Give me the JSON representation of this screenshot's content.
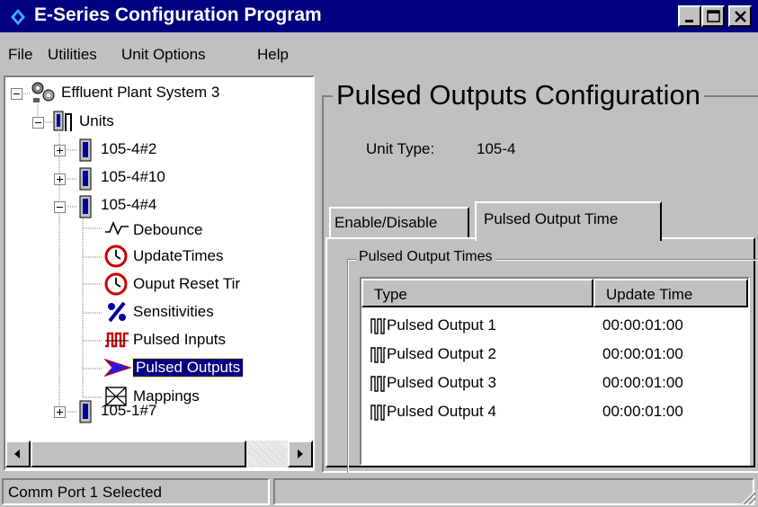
{
  "window": {
    "title": "E-Series Configuration Program",
    "controls": {
      "minimize": "minimize-icon",
      "maximize": "maximize-icon",
      "close": "close-icon"
    }
  },
  "menu": {
    "items": [
      {
        "label": "File"
      },
      {
        "label": "Utilities"
      },
      {
        "label": "Unit Options"
      },
      {
        "label": "Help"
      }
    ]
  },
  "tree": {
    "nodes": [
      {
        "label": "Effluent Plant System 3",
        "icon": "plant-system-icon",
        "expander": "minus"
      },
      {
        "label": "Units",
        "icon": "units-icon",
        "expander": "minus"
      },
      {
        "label": "105-4#2",
        "icon": "unit-icon",
        "expander": "plus"
      },
      {
        "label": "105-4#10",
        "icon": "unit-icon",
        "expander": "plus"
      },
      {
        "label": "105-4#4",
        "icon": "unit-icon",
        "expander": "minus"
      },
      {
        "label": "Debounce",
        "icon": "debounce-icon"
      },
      {
        "label": "UpdateTimes",
        "icon": "clock-icon"
      },
      {
        "label": "Ouput Reset Tir",
        "icon": "clock-icon"
      },
      {
        "label": "Sensitivities",
        "icon": "percent-icon"
      },
      {
        "label": "Pulsed Inputs",
        "icon": "pulsed-inputs-icon"
      },
      {
        "label": "Pulsed Outputs",
        "icon": "pulsed-outputs-icon",
        "selected": true
      },
      {
        "label": "Mappings",
        "icon": "mappings-icon"
      },
      {
        "label": "105-1#7",
        "icon": "unit-icon",
        "expander": "plus"
      }
    ]
  },
  "config": {
    "title": "Pulsed Outputs Configuration",
    "unit_type_label": "Unit Type:",
    "unit_type_value": "105-4",
    "tabs": [
      {
        "label": "Enable/Disable",
        "active": false
      },
      {
        "label": "Pulsed Output Time",
        "active": true
      }
    ],
    "group_title": "Pulsed Output Times",
    "table": {
      "columns": [
        "Type",
        "Update Time"
      ],
      "rows": [
        {
          "type": "Pulsed Output 1",
          "time": "00:00:01:00"
        },
        {
          "type": "Pulsed Output 2",
          "time": "00:00:01:00"
        },
        {
          "type": "Pulsed Output 3",
          "time": "00:00:01:00"
        },
        {
          "type": "Pulsed Output 4",
          "time": "00:00:01:00"
        }
      ]
    }
  },
  "status": {
    "panes": [
      "Comm Port 1 Selected",
      ""
    ]
  },
  "colors": {
    "titlebar": "#000080",
    "face": "#c0c0c0",
    "selection": "#000080",
    "clock_red": "#cc0000",
    "arrow_blue": "#1a1aff"
  }
}
